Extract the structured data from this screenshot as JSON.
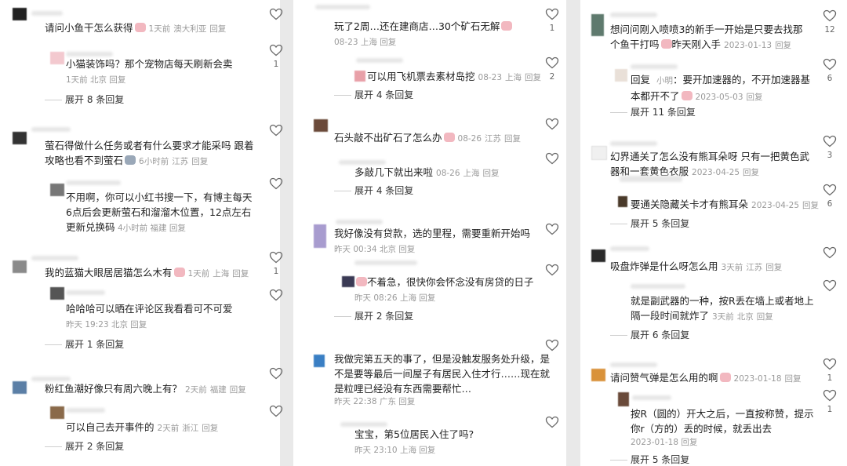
{
  "expand_suffix": "条回复",
  "reply_word": "回复",
  "panels": [
    {
      "comments": [
        {
          "text": "请问小鱼干怎么获得",
          "time": "1天前",
          "loc": "澳大利亚"
        },
        {
          "text": "小猫装饰吗？那个宠物店每天刷新会卖",
          "time": "1天前",
          "loc": "北京"
        },
        {
          "text": "萤石得做什么任务或者有什么要求才能采吗 跟着攻略也看不到萤石",
          "time": "6小时前",
          "loc": "江苏"
        },
        {
          "text": "不用啊，你可以小红书搜一下，有博主每天6点后会更新萤石和溜溜木位置，12点左右更新兑换码",
          "time": "4小时前",
          "loc": "福建"
        },
        {
          "text": "我的蓝猫大眼居居猫怎么木有",
          "time": "1天前",
          "loc": "上海"
        },
        {
          "text": "哈哈哈可以晒在评论区我看看可不可爱",
          "time": "昨天 19:23",
          "loc": "北京"
        },
        {
          "text": "粉红鱼潮好像只有周六晚上有？",
          "time": "2天前",
          "loc": "福建"
        },
        {
          "text": "可以自己去开事件的",
          "time": "2天前",
          "loc": "浙江"
        }
      ],
      "expands": [
        "展开 8",
        "展开 1",
        "展开 2"
      ],
      "likes": [
        "",
        "1",
        "",
        "",
        "1",
        "",
        "",
        ""
      ]
    },
    {
      "comments": [
        {
          "text": "玩了2周…还在建商店…30个矿石无解",
          "time": "08-23",
          "loc": "上海"
        },
        {
          "text": "可以用飞机票去素材岛挖",
          "time": "08-23",
          "loc": "上海"
        },
        {
          "text": "石头敲不出矿石了怎么办",
          "time": "08-26",
          "loc": "江苏"
        },
        {
          "text": "多敲几下就出来啦",
          "time": "08-26",
          "loc": "上海"
        },
        {
          "text": "我好像没有贷款，选的里程，需要重新开始吗",
          "time": "昨天 00:34",
          "loc": "北京"
        },
        {
          "text": "不着急，很快你会怀念没有房贷的日子",
          "time": "昨天 08:26",
          "loc": "上海"
        },
        {
          "text": "我做完第五天的事了，但是没触发服务处升级，是不是要等最后一间屋子有居民入住才行……现在就是粒哩已经没有东西需要帮忙…",
          "time": "昨天 22:38",
          "loc": "广东"
        },
        {
          "text": "宝宝，第5位居民入住了吗?",
          "time": "昨天 23:10",
          "loc": "上海"
        }
      ],
      "expands": [
        "展开 4",
        "展开 4",
        "展开 2"
      ],
      "likes": [
        "1",
        "2",
        "",
        "",
        "",
        "",
        "",
        ""
      ]
    },
    {
      "comments": [
        {
          "text": "想问问刚入喷喷3的新手一开始是只要去找那个鱼干打吗",
          "extra": "昨天刚入手",
          "time": "2023-01-13",
          "loc": ""
        },
        {
          "text": "回复",
          "name": "小明",
          "text2": "要开加速器的，不开加速器基本都开不了",
          "time": "2023-05-03",
          "loc": ""
        },
        {
          "text": "幻界通关了怎么没有熊耳朵呀 只有一把黄色武器和一套黄色衣服",
          "time": "2023-04-25",
          "loc": ""
        },
        {
          "text": "要通关隐藏关卡才有熊耳朵",
          "time": "2023-04-25",
          "loc": ""
        },
        {
          "text": "吸盘炸弹是什么呀怎么用",
          "time": "3天前",
          "loc": "江苏"
        },
        {
          "text": "就是副武器的一种，按R丢在墙上或者地上隔一段时间就炸了",
          "time": "3天前",
          "loc": "北京"
        },
        {
          "text": "请问赞气弹是怎么用的啊",
          "time": "2023-01-18",
          "loc": ""
        },
        {
          "text": "按R（圆的）开大之后，一直按称赞，提示你r（方的）丢的时候，就丢出去",
          "time": "2023-01-18",
          "loc": ""
        }
      ],
      "expands": [
        "展开 11",
        "展开 5",
        "展开 6",
        "展开 5"
      ],
      "likes": [
        "12",
        "6",
        "3",
        "6",
        "",
        "",
        "1",
        "1"
      ]
    }
  ]
}
